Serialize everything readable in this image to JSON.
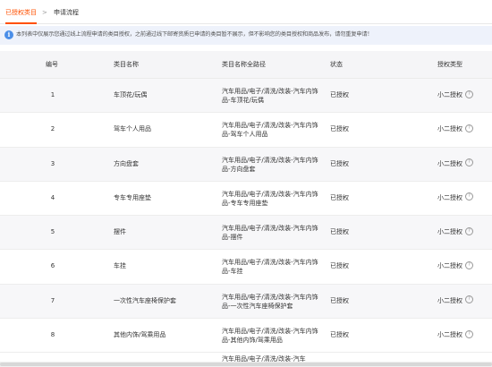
{
  "tabs": [
    {
      "label": "已授权类目",
      "active": true
    },
    {
      "label": "申请流程",
      "active": false
    }
  ],
  "tab_separator": ">",
  "notice": {
    "icon": "info-icon",
    "icon_glyph": "i",
    "text": "本列表中仅展示您通过线上流程申请的类目授权，之前通过线下邮寄资质已申请的类目暂不展示，但不影响您的类目授权和商品发布，请勿重复申请！"
  },
  "table": {
    "columns": [
      "编号",
      "类目名称",
      "类目名称全路径",
      "状态",
      "授权类型"
    ],
    "rows": [
      {
        "id": "1",
        "name": "车顶花/玩偶",
        "path": "汽车用品/电子/清洗/改装-汽车内饰品-车顶花/玩偶",
        "status": "已授权",
        "type": "小二授权"
      },
      {
        "id": "2",
        "name": "驾车个人用品",
        "path": "汽车用品/电子/清洗/改装-汽车内饰品-驾车个人用品",
        "status": "已授权",
        "type": "小二授权"
      },
      {
        "id": "3",
        "name": "方向盘套",
        "path": "汽车用品/电子/清洗/改装-汽车内饰品-方向盘套",
        "status": "已授权",
        "type": "小二授权"
      },
      {
        "id": "4",
        "name": "专车专用座垫",
        "path": "汽车用品/电子/清洗/改装-汽车内饰品-专车专用座垫",
        "status": "已授权",
        "type": "小二授权"
      },
      {
        "id": "5",
        "name": "摆件",
        "path": "汽车用品/电子/清洗/改装-汽车内饰品-摆件",
        "status": "已授权",
        "type": "小二授权"
      },
      {
        "id": "6",
        "name": "车挂",
        "path": "汽车用品/电子/清洗/改装-汽车内饰品-车挂",
        "status": "已授权",
        "type": "小二授权"
      },
      {
        "id": "7",
        "name": "一次性汽车座椅保护套",
        "path": "汽车用品/电子/清洗/改装-汽车内饰品-一次性汽车座椅保护套",
        "status": "已授权",
        "type": "小二授权"
      },
      {
        "id": "8",
        "name": "其他内饰/驾乘用品",
        "path": "汽车用品/电子/清洗/改装-汽车内饰品-其他内饰/驾乘用品",
        "status": "已授权",
        "type": "小二授权"
      }
    ],
    "partial_row": {
      "path": "汽车用品/电子/清洗/改装-汽车"
    },
    "help_icon_glyph": "?"
  }
}
